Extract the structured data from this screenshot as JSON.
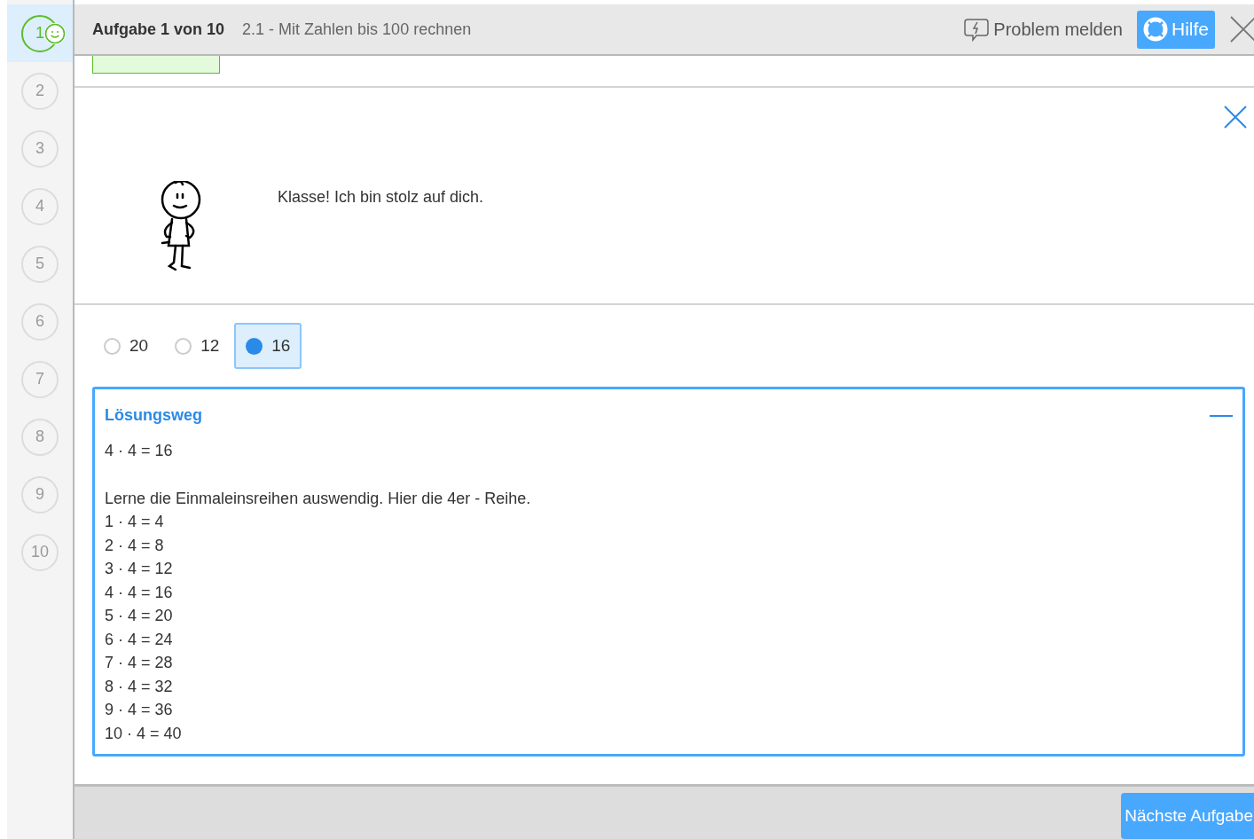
{
  "sidebar": {
    "items": [
      {
        "label": "1",
        "selected": true,
        "solved": true
      },
      {
        "label": "2",
        "selected": false,
        "solved": false
      },
      {
        "label": "3",
        "selected": false,
        "solved": false
      },
      {
        "label": "4",
        "selected": false,
        "solved": false
      },
      {
        "label": "5",
        "selected": false,
        "solved": false
      },
      {
        "label": "6",
        "selected": false,
        "solved": false
      },
      {
        "label": "7",
        "selected": false,
        "solved": false
      },
      {
        "label": "8",
        "selected": false,
        "solved": false
      },
      {
        "label": "9",
        "selected": false,
        "solved": false
      },
      {
        "label": "10",
        "selected": false,
        "solved": false
      }
    ]
  },
  "header": {
    "task_counter": "Aufgabe 1 von 10",
    "topic": "2.1 - Mit Zahlen bis 100 rechnen",
    "report_button": "Problem melden",
    "help_button": "Hilfe"
  },
  "feedback_message": "Klasse! Ich bin stolz auf dich.",
  "answers": [
    {
      "label": "20",
      "selected": false
    },
    {
      "label": "12",
      "selected": false
    },
    {
      "label": "16",
      "selected": true
    }
  ],
  "solution": {
    "title": "Lösungsweg",
    "expanded": true,
    "result": "4 · 4 = 16",
    "hint": "Lerne die Einmaleinsreihen auswendig. Hier die 4er - Reihe.",
    "lines": [
      "1 · 4 = 4",
      "2 · 4 = 8",
      "3 · 4 = 12",
      "4 · 4 = 16",
      "5 · 4 = 20",
      "6 · 4 = 24",
      "7 · 4 = 28",
      "8 · 4 = 32",
      "9 · 4 = 36",
      "10 · 4 = 40"
    ]
  },
  "footer": {
    "next_button": "Nächste Aufgabe"
  }
}
